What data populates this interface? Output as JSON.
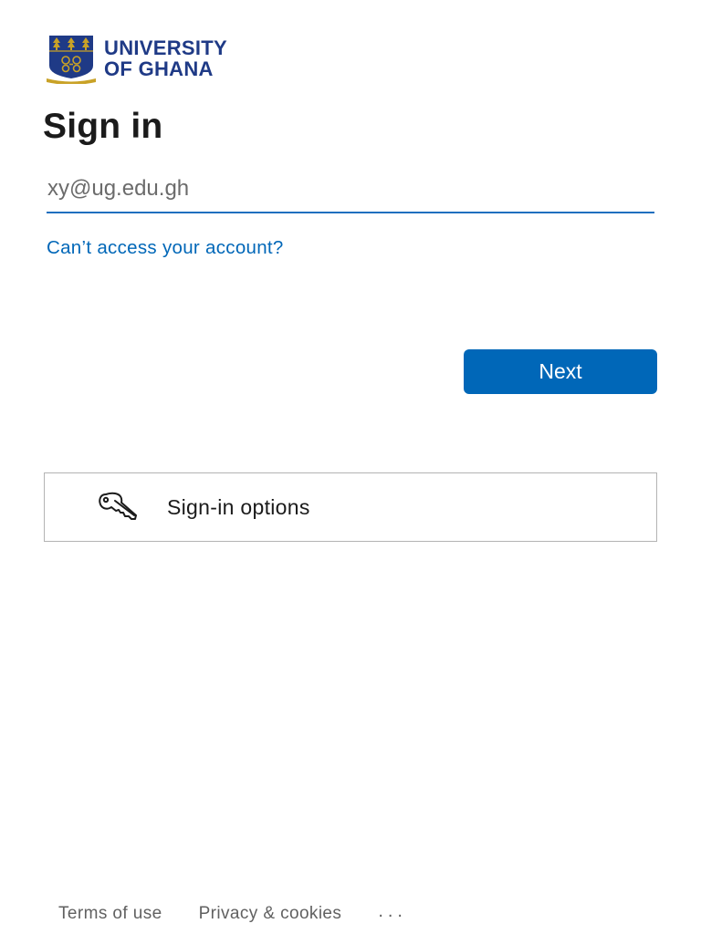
{
  "header": {
    "logo_line1": "UNIVERSITY",
    "logo_line2": "OF GHANA",
    "crest_icon": "university-crest-icon"
  },
  "main": {
    "title": "Sign in",
    "email": {
      "value": "",
      "placeholder": "xy@ug.edu.gh"
    },
    "cant_access_label": "Can’t access your account?",
    "next_label": "Next",
    "signin_options_label": "Sign-in options",
    "signin_options_icon": "key-icon"
  },
  "footer": {
    "terms_label": "Terms of use",
    "privacy_label": "Privacy & cookies",
    "more_label": "..."
  },
  "colors": {
    "accent": "#0067b8",
    "brand": "#1f3a86",
    "text": "#1b1b1b",
    "muted": "#616161",
    "border": "#b3b3b3"
  }
}
